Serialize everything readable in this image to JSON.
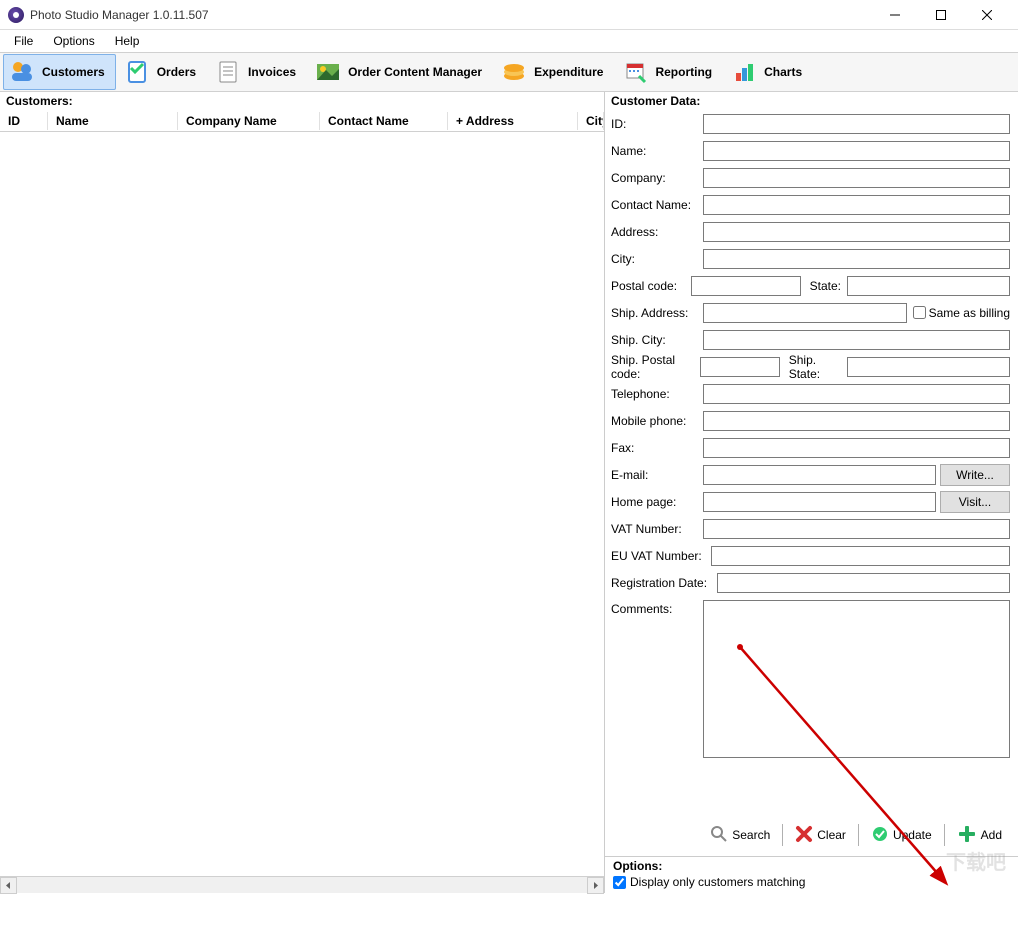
{
  "window": {
    "title": "Photo Studio Manager 1.0.11.507"
  },
  "menu": {
    "items": [
      "File",
      "Options",
      "Help"
    ]
  },
  "toolbar": {
    "items": [
      {
        "label": "Customers",
        "active": true
      },
      {
        "label": "Orders",
        "active": false
      },
      {
        "label": "Invoices",
        "active": false
      },
      {
        "label": "Order Content Manager",
        "active": false
      },
      {
        "label": "Expenditure",
        "active": false
      },
      {
        "label": "Reporting",
        "active": false
      },
      {
        "label": "Charts",
        "active": false
      }
    ]
  },
  "left": {
    "section_title": "Customers:",
    "columns": [
      "ID",
      "Name",
      "Company Name",
      "Contact Name",
      "+ Address",
      "City"
    ]
  },
  "right": {
    "section_title": "Customer Data:",
    "fields": {
      "id": "ID:",
      "name": "Name:",
      "company": "Company:",
      "contact_name": "Contact Name:",
      "address": "Address:",
      "city": "City:",
      "postal_code": "Postal code:",
      "state": "State:",
      "ship_address": "Ship. Address:",
      "same_as_billing": "Same as billing",
      "ship_city": "Ship. City:",
      "ship_postal_code": "Ship. Postal code:",
      "ship_state": "Ship. State:",
      "telephone": "Telephone:",
      "mobile_phone": "Mobile phone:",
      "fax": "Fax:",
      "email": "E-mail:",
      "write_btn": "Write...",
      "home_page": "Home page:",
      "visit_btn": "Visit...",
      "vat_number": "VAT Number:",
      "eu_vat_number": "EU VAT Number:",
      "registration_date": "Registration Date:",
      "comments": "Comments:"
    },
    "actions": {
      "search": "Search",
      "clear": "Clear",
      "update": "Update",
      "add": "Add"
    },
    "options": {
      "title": "Options:",
      "display_matching": "Display only customers matching",
      "display_matching_checked": true
    }
  },
  "watermark": "下载吧"
}
